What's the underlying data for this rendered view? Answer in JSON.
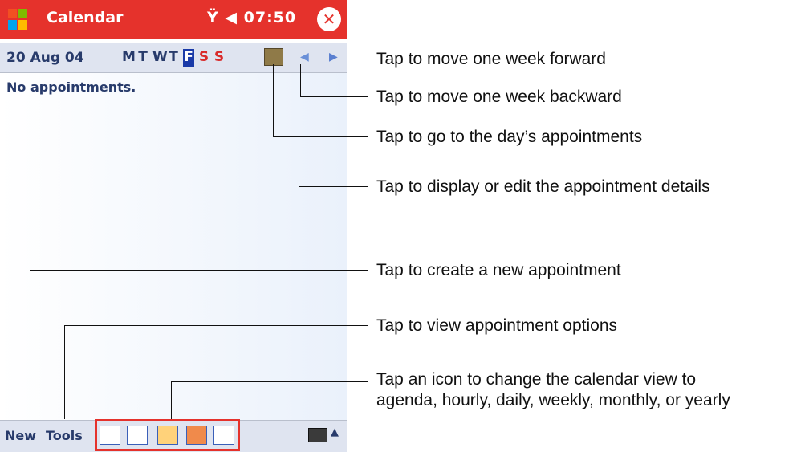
{
  "title_bar": {
    "app_title": "Calendar",
    "status": "07:50",
    "colors": {
      "accent": "#e5322c"
    }
  },
  "date_bar": {
    "date": "20 Aug 04",
    "weekdays": [
      "M",
      "T",
      "W",
      "T",
      "F",
      "S",
      "S"
    ],
    "selected_day_index": 4
  },
  "content": {
    "empty_text": "No appointments."
  },
  "bottom_bar": {
    "menu_new": "New",
    "menu_tools": "Tools",
    "view_icons": [
      "agenda",
      "hourly",
      "daily",
      "weekly",
      "monthly"
    ]
  },
  "annotations": [
    "Tap to move one week forward",
    "Tap to move one week backward",
    "Tap to go to the day’s appointments",
    "Tap to display or edit the appointment details",
    "Tap to create a new appointment",
    "Tap to view appointment options",
    "Tap an icon to change the calendar view to",
    "agenda, hourly, daily, weekly, monthly, or yearly"
  ]
}
